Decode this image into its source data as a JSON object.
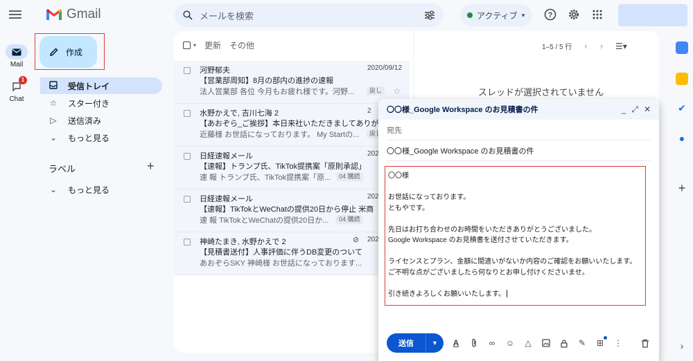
{
  "app": {
    "name": "Gmail"
  },
  "rail": {
    "mail_label": "Mail",
    "chat_label": "Chat",
    "chat_badge": "1"
  },
  "search": {
    "placeholder": "メールを検索"
  },
  "status": {
    "label": "アクティブ"
  },
  "compose_button": {
    "label": "作成"
  },
  "sidebar": {
    "items": [
      {
        "label": "受信トレイ",
        "icon": "inbox-icon",
        "active": true
      },
      {
        "label": "スター付き",
        "icon": "star-icon"
      },
      {
        "label": "送信済み",
        "icon": "send-icon"
      },
      {
        "label": "もっと見る",
        "icon": "chevron-down-icon"
      }
    ],
    "labels_title": "ラベル",
    "labels_more": "もっと見る"
  },
  "toolbar": {
    "refresh_label": "更新",
    "more_label": "その他",
    "page_range": "1–5 / 5 行"
  },
  "emails": [
    {
      "sender": "河野郁夫",
      "date": "2020/09/12",
      "subject": "【営業部周知】8月の部内の進捗の速報",
      "snippet": "法人営業部 各位 今月もお疲れ様です。河野...",
      "tag": "戻し"
    },
    {
      "sender": "水野かえで, 吉川七海 2",
      "date": "2",
      "subject": "【あおぞら_ご挨拶】本日来社いただきましてありが",
      "snippet": "近藤様 お世話になっております。 My Startの...",
      "tag": "戻し"
    },
    {
      "sender": "日経速報メール",
      "date": "202",
      "subject": "【速報】トランプ氏、TikTok提携案「原則承認」",
      "snippet": "速 報 トランプ氏、TikTok提携案「原...",
      "tag": "04 購読"
    },
    {
      "sender": "日経速報メール",
      "date": "202",
      "subject": "【速報】TikTokとWeChatの提供20日から停止 米商",
      "snippet": "速 報 TikTokとWeChatの提供20日か...",
      "tag": "04 購読"
    },
    {
      "sender": "神崎たまき, 水野かえで 2",
      "date": "202",
      "subject": "【見積書送付】人事評価に伴うDB変更のついて",
      "snippet": "あおぞらSKY 神崎様 お世話になっております...",
      "tag": ""
    }
  ],
  "reading_pane": {
    "empty_text": "スレッドが選択されていません"
  },
  "compose_window": {
    "title": "〇〇様_Google Workspace のお見積書の件",
    "to_label": "宛先",
    "subject": "〇〇様_Google Workspace のお見積書の件",
    "body_lines": [
      "〇〇様",
      "",
      "お世話になっております。",
      "ともやです。",
      "",
      "先日はお打ち合わせのお時間をいただきありがとうございました。",
      "Google Workspace のお見積書を送付させていただきます。",
      "",
      "ライセンスとプラン、金額に間違いがないか内容のご確認をお願いいたします。",
      "ご不明な点がございましたら何なりとお申し付けくださいませ。",
      "",
      "引き続きよろしくお願いいたします。"
    ],
    "send_label": "送信"
  },
  "colors": {
    "accent": "#0b57d0",
    "compose_bg": "#c2e7ff",
    "active_nav": "#d3e3fd",
    "highlight_red": "#e53935"
  }
}
